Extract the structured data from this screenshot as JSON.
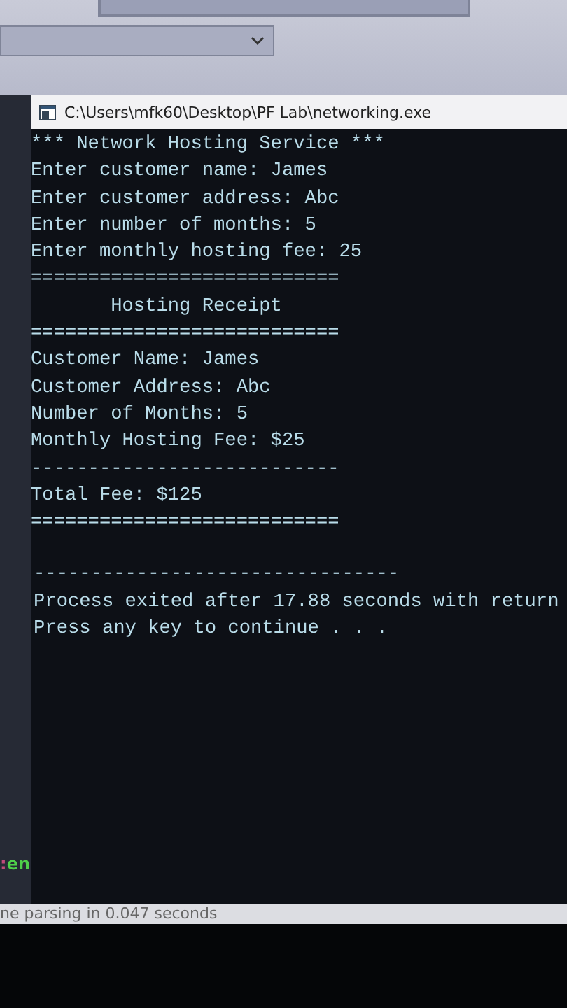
{
  "console_window": {
    "title": "C:\\Users\\mfk60\\Desktop\\PF Lab\\networking.exe",
    "output": [
      "*** Network Hosting Service ***",
      "Enter customer name: James",
      "Enter customer address: Abc",
      "Enter number of months: 5",
      "Enter monthly hosting fee: 25",
      "===========================",
      "       Hosting Receipt",
      "===========================",
      "Customer Name: James",
      "Customer Address: Abc",
      "Number of Months: 5",
      "Monthly Hosting Fee: $25",
      "---------------------------",
      "Total Fee: $125",
      "==========================="
    ],
    "process": [
      "--------------------------------",
      "Process exited after 17.88 seconds with return",
      "Press any key to continue . . ."
    ]
  },
  "side_panel": {
    "prompt_mark": ":",
    "language": "en"
  },
  "status_bar": {
    "text": "ne parsing in 0.047 seconds"
  }
}
